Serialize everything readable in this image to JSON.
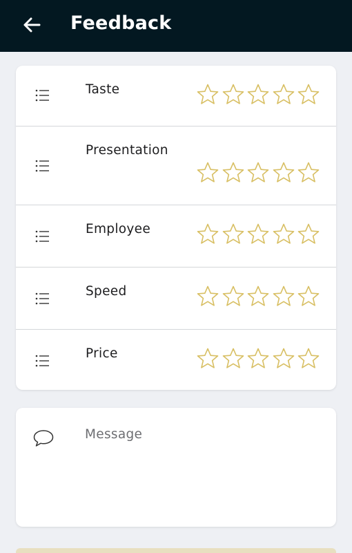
{
  "appbar": {
    "title": "Feedback",
    "back_icon": "arrow-left-icon",
    "background": "#031821"
  },
  "ratings": {
    "star_color": "#d8bf63",
    "items": [
      {
        "label": "Taste",
        "icon": "list-icon",
        "rating": 0,
        "max": 5
      },
      {
        "label": "Presentation",
        "icon": "list-icon",
        "rating": 0,
        "max": 5
      },
      {
        "label": "Employee",
        "icon": "list-icon",
        "rating": 0,
        "max": 5
      },
      {
        "label": "Speed",
        "icon": "list-icon",
        "rating": 0,
        "max": 5
      },
      {
        "label": "Price",
        "icon": "list-icon",
        "rating": 0,
        "max": 5
      }
    ]
  },
  "message": {
    "icon": "chat-bubble-icon",
    "placeholder": "Message",
    "value": ""
  }
}
